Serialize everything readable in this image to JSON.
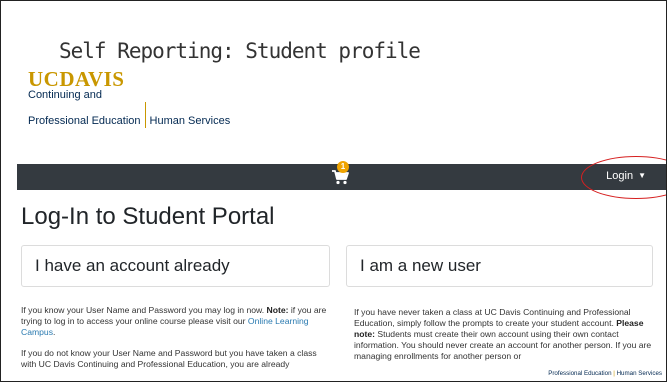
{
  "slide_title": "Self Reporting: Student profile",
  "logo": {
    "brand": "UCDAVIS",
    "line1": "Continuing and",
    "line2": "Professional Education",
    "line3": "Human Services"
  },
  "navbar": {
    "cart_count": "1",
    "login_label": "Login"
  },
  "page_heading": "Log-In to Student Portal",
  "cards": {
    "left_title": "I have an account already",
    "right_title": "I am a new user"
  },
  "left_text": {
    "p1_a": "If you know your User Name and Password you may log in now.",
    "p1_note": "Note:",
    "p1_b": "if you are trying to log in to access your online course please visit our",
    "p1_link": "Online Learning Campus",
    "p1_end": ".",
    "p2": "If you do not know your User Name and Password but you have taken a class with UC Davis Continuing and Professional Education, you are already"
  },
  "right_text": {
    "p1_a": "If you have never taken a class at UC Davis Continuing and Professional Education, simply follow the prompts to create your student account.",
    "p1_note": "Please note:",
    "p1_b": "Students must create their own account using their own contact information. You should never create an account for another person.  If you are managing enrollments for another person or"
  },
  "footer_mark": {
    "left": "Professional Education",
    "sep": "|",
    "right": "Human Services"
  },
  "colors": {
    "navbar": "#343a40",
    "brand_gold": "#c99700",
    "brand_blue": "#022851",
    "link": "#2a7ab0",
    "badge": "#f0a400",
    "annotation_red": "#d62020"
  }
}
